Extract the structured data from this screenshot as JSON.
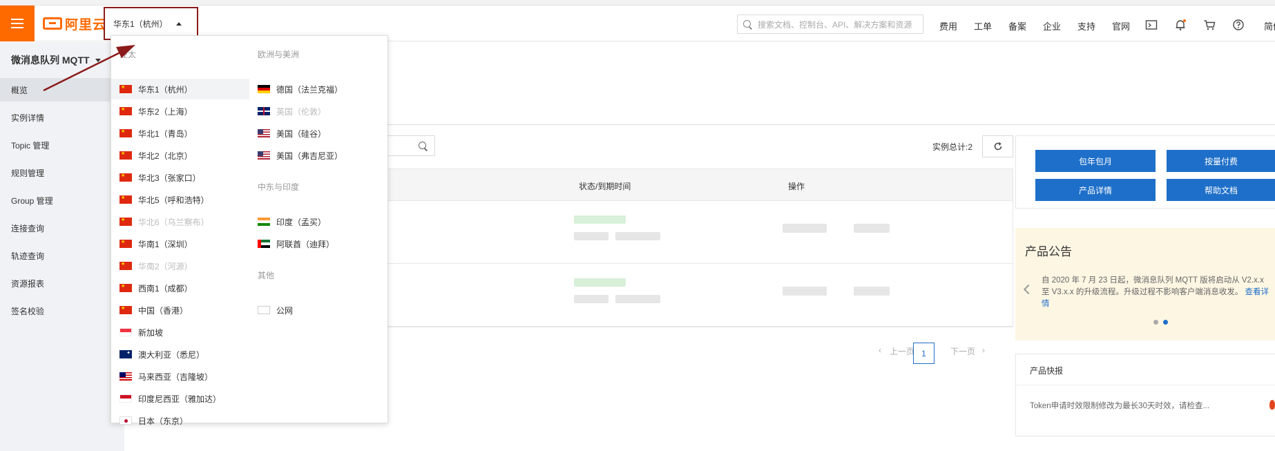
{
  "topbar": {
    "logo_text": "阿里云",
    "region_selected": "华东1（杭州）",
    "search_placeholder": "搜索文档、控制台、API、解决方案和资源",
    "nav": [
      "费用",
      "工单",
      "备案",
      "企业",
      "支持",
      "官网"
    ],
    "lang": "简体"
  },
  "sidebar": {
    "title": "微消息队列 MQTT",
    "items": [
      "概览",
      "实例详情",
      "Topic 管理",
      "规则管理",
      "Group 管理",
      "连接查询",
      "轨迹查询",
      "资源报表",
      "签名校验"
    ]
  },
  "region_dropdown": {
    "groups": [
      {
        "label": "亚太",
        "regions": [
          {
            "name": "华东1（杭州）",
            "flag": "cn",
            "state": "selected"
          },
          {
            "name": "华东2（上海）",
            "flag": "cn",
            "state": "normal"
          },
          {
            "name": "华北1（青岛）",
            "flag": "cn",
            "state": "normal"
          },
          {
            "name": "华北2（北京）",
            "flag": "cn",
            "state": "normal"
          },
          {
            "name": "华北3（张家口）",
            "flag": "cn",
            "state": "normal"
          },
          {
            "name": "华北5（呼和浩特）",
            "flag": "cn",
            "state": "normal"
          },
          {
            "name": "华北6（乌兰察布）",
            "flag": "cn",
            "state": "disabled"
          },
          {
            "name": "华南1（深圳）",
            "flag": "cn",
            "state": "normal"
          },
          {
            "name": "华南2（河源）",
            "flag": "cn",
            "state": "disabled"
          },
          {
            "name": "西南1（成都）",
            "flag": "cn",
            "state": "normal"
          },
          {
            "name": "中国（香港）",
            "flag": "cn",
            "state": "normal"
          },
          {
            "name": "新加坡",
            "flag": "sg",
            "state": "normal"
          },
          {
            "name": "澳大利亚（悉尼）",
            "flag": "au",
            "state": "normal"
          },
          {
            "name": "马来西亚（吉隆坡）",
            "flag": "my",
            "state": "normal"
          },
          {
            "name": "印度尼西亚（雅加达）",
            "flag": "id",
            "state": "normal"
          },
          {
            "name": "日本（东京）",
            "flag": "jp",
            "state": "normal"
          }
        ]
      },
      {
        "label": "欧洲与美洲",
        "regions": [
          {
            "name": "德国（法兰克福）",
            "flag": "de",
            "state": "normal"
          },
          {
            "name": "英国（伦敦）",
            "flag": "uk",
            "state": "disabled"
          },
          {
            "name": "美国（硅谷）",
            "flag": "us",
            "state": "normal"
          },
          {
            "name": "美国（弗吉尼亚）",
            "flag": "us",
            "state": "normal"
          }
        ]
      },
      {
        "label": "中东与印度",
        "regions": [
          {
            "name": "印度（孟买）",
            "flag": "in",
            "state": "normal"
          },
          {
            "name": "阿联酋（迪拜）",
            "flag": "ae",
            "state": "normal"
          }
        ]
      },
      {
        "label": "其他",
        "regions": [
          {
            "name": "公网",
            "flag": "global",
            "state": "normal"
          }
        ]
      }
    ]
  },
  "main": {
    "total_label": "实例总计:2",
    "table_headers": [
      "状态/到期时间",
      "操作"
    ],
    "pager": {
      "prev": "上一页",
      "current": "1",
      "next": "下一页"
    }
  },
  "right_panel": {
    "buttons": [
      "包年包月",
      "按量付费",
      "产品详情",
      "帮助文档"
    ],
    "notice_title": "产品公告",
    "notice_text": "自 2020 年 7 月 23 日起，微消息队列 MQTT 版将启动从 V2.x.x 至 V3.x.x 的升级流程。升级过程不影响客户端消息收发。",
    "notice_link": "查看详情",
    "news_title": "产品快报",
    "news_item": "Token申请时效限制修改为最长30天时效，请检查..."
  },
  "colors": {
    "brand_orange": "#ff6a00",
    "primary_blue": "#1e6fc9",
    "annotation_red": "#8b1a1a",
    "notice_bg": "#fdf6e3"
  }
}
